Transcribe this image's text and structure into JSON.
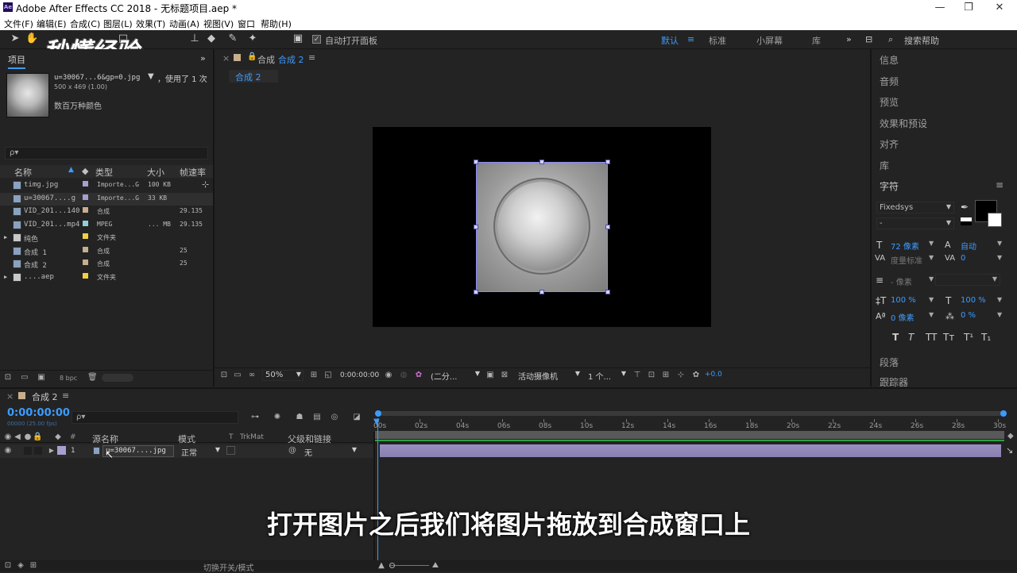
{
  "window": {
    "title": "Adobe After Effects CC 2018 - 无标题项目.aep *",
    "logo": "Ae",
    "controls": [
      "—",
      "❐",
      "✕"
    ]
  },
  "menu": [
    "文件(F)",
    "编辑(E)",
    "合成(C)",
    "图层(L)",
    "效果(T)",
    "动画(A)",
    "视图(V)",
    "窗口",
    "帮助(H)"
  ],
  "toolbar": {
    "auto_open": "自动打开面板",
    "workspaces": [
      "默认",
      "标准",
      "小屏幕",
      "库"
    ],
    "search_placeholder": "搜索帮助"
  },
  "watermark": "秒懂经验",
  "project": {
    "tab": "项目",
    "selected_name": "u=30067...6&gp=0.jpg",
    "used_info": "，使用了 1 次",
    "dims": "500 x 469 (1.00)",
    "colors": "数百万种颜色",
    "search_icon": "ρ▾",
    "columns": [
      "名称",
      "类型",
      "大小",
      "帧速率"
    ],
    "items": [
      {
        "name": "timg.jpg",
        "type": "Importe...G",
        "size": "100 KB",
        "fps": "",
        "color": "#a79fd0"
      },
      {
        "name": "u=30067....g",
        "type": "Importe...G",
        "size": "33 KB",
        "fps": "",
        "color": "#a79fd0"
      },
      {
        "name": "VID_201...140",
        "type": "合成",
        "size": "",
        "fps": "29.135",
        "color": "#c7ae8c"
      },
      {
        "name": "VID_201...mp4",
        "type": "MPEG",
        "size": "... MB",
        "fps": "29.135",
        "color": "#8ed0d8"
      },
      {
        "name": "纯色",
        "type": "文件夹",
        "size": "",
        "fps": "",
        "color": "#f0d040"
      },
      {
        "name": "合成 1",
        "type": "合成",
        "size": "",
        "fps": "25",
        "color": "#c7ae8c"
      },
      {
        "name": "合成 2",
        "type": "合成",
        "size": "",
        "fps": "25",
        "color": "#c7ae8c"
      },
      {
        "name": "....aep",
        "type": "文件夹",
        "size": "",
        "fps": "",
        "color": "#f0d040"
      }
    ],
    "bpc": "8 bpc"
  },
  "viewer": {
    "tab_label": "合成",
    "tab_name": "合成 2",
    "subtab": "合成 2",
    "zoom": "50%",
    "timecode": "0:00:00:00",
    "resolution": "(二分...",
    "camera": "活动摄像机",
    "views": "1 个...",
    "exposure": "+0.0"
  },
  "right_panel": {
    "sections": [
      "信息",
      "音频",
      "预览",
      "效果和预设",
      "对齐",
      "库"
    ],
    "char_title": "字符",
    "font": "Fixedsys",
    "style": "-",
    "size": "72 像素",
    "leading": "自动",
    "kerning": "度量标准",
    "tracking": "0",
    "stroke": "- 像素",
    "vscale": "100 %",
    "hscale": "100 %",
    "baseline": "0 像素",
    "tsume": "0 %",
    "text_buttons": [
      "T",
      "T",
      "TT",
      "Tт",
      "T¹",
      "T₁"
    ],
    "para_title": "段落",
    "tracker_title": "跟踪器"
  },
  "timeline": {
    "tab": "合成 2",
    "timecode": "0:00:00:00",
    "fps_info": "00000 (25.00 fps)",
    "ticks": [
      "00s",
      "02s",
      "04s",
      "06s",
      "08s",
      "10s",
      "12s",
      "14s",
      "16s",
      "18s",
      "20s",
      "22s",
      "24s",
      "26s",
      "28s",
      "30s"
    ],
    "cols": {
      "num": "#",
      "source": "源名称",
      "mode": "模式",
      "t": "T",
      "trkmat": "TrkMat",
      "parent": "父级和链接"
    },
    "layer": {
      "index": "1",
      "name": "u=30067....jpg",
      "mode": "正常",
      "parent": "无"
    },
    "bottom": "切换开关/模式"
  },
  "subtitle": "打开图片之后我们将图片拖放到合成窗口上"
}
